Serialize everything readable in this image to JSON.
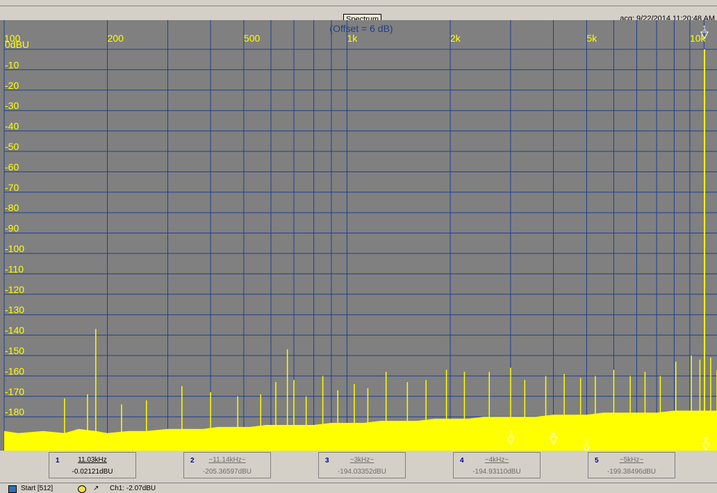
{
  "header": {
    "title": "Spectrum",
    "acq": "acq: 9/22/2014 11:20:48 AM"
  },
  "colors": {
    "plot_bg": "#808080",
    "grid": "#1f3f8c",
    "trace": "#ffff00",
    "label": "#ffff00",
    "title_label": "#1f3f8c"
  },
  "chart_data": {
    "type": "line",
    "title": "(Offset = 6 dB)",
    "xlabel": "",
    "ylabel": "",
    "x_scale": "log",
    "xlim": [
      100,
      12000
    ],
    "ylim": [
      -195,
      0
    ],
    "grid": true,
    "x_tick_labels": [
      {
        "value": 100,
        "label": "100"
      },
      {
        "value": 200,
        "label": "200"
      },
      {
        "value": 500,
        "label": "500"
      },
      {
        "value": 1000,
        "label": "1k"
      },
      {
        "value": 2000,
        "label": "2k"
      },
      {
        "value": 5000,
        "label": "5k"
      },
      {
        "value": 10000,
        "label": "10k"
      }
    ],
    "x_minor_grid": [
      300,
      400,
      600,
      700,
      800,
      900,
      3000,
      4000,
      6000,
      7000,
      8000,
      9000,
      11000
    ],
    "y_ticks": [
      {
        "value": 0,
        "label": "0dBU"
      },
      {
        "value": -10,
        "label": "-10"
      },
      {
        "value": -20,
        "label": "-20"
      },
      {
        "value": -30,
        "label": "-30"
      },
      {
        "value": -40,
        "label": "-40"
      },
      {
        "value": -50,
        "label": "-50"
      },
      {
        "value": -60,
        "label": "-60"
      },
      {
        "value": -70,
        "label": "-70"
      },
      {
        "value": -80,
        "label": "-80"
      },
      {
        "value": -90,
        "label": "-90"
      },
      {
        "value": -100,
        "label": "-100"
      },
      {
        "value": -110,
        "label": "-110"
      },
      {
        "value": -120,
        "label": "-120"
      },
      {
        "value": -130,
        "label": "-130"
      },
      {
        "value": -140,
        "label": "-140"
      },
      {
        "value": -150,
        "label": "-150"
      },
      {
        "value": -160,
        "label": "-160"
      },
      {
        "value": -170,
        "label": "-170"
      },
      {
        "value": -180,
        "label": "-180"
      }
    ],
    "series": [
      {
        "x": [
          100,
          110,
          130,
          150,
          165,
          185,
          200,
          230,
          260,
          300,
          340,
          380,
          420,
          470,
          520,
          580,
          650,
          720,
          800,
          900,
          1000,
          1120,
          1250,
          1400,
          1600,
          1800,
          2000,
          2250,
          2500,
          2800,
          3150,
          3550,
          4000,
          4500,
          5000,
          5600,
          6300,
          7100,
          8000,
          9000,
          10000,
          11030,
          11500,
          12000
        ],
        "y": [
          -187,
          -188,
          -187,
          -188,
          -186,
          -187,
          -188,
          -187,
          -187,
          -186,
          -186,
          -186,
          -185,
          -185,
          -185,
          -184,
          -184,
          -184,
          -184,
          -183,
          -183,
          -183,
          -182,
          -182,
          -182,
          -181,
          -181,
          -181,
          -180,
          -180,
          -180,
          -180,
          -179,
          -179,
          -179,
          -178,
          -178,
          -178,
          -178,
          -177,
          -177,
          -0.02121,
          -177,
          -177
        ]
      }
    ],
    "spurs": [
      {
        "x": 185,
        "y": -137
      },
      {
        "x": 150,
        "y": -171
      },
      {
        "x": 175,
        "y": -169
      },
      {
        "x": 220,
        "y": -174
      },
      {
        "x": 260,
        "y": -172
      },
      {
        "x": 330,
        "y": -165
      },
      {
        "x": 400,
        "y": -168
      },
      {
        "x": 480,
        "y": -170
      },
      {
        "x": 560,
        "y": -169
      },
      {
        "x": 620,
        "y": -163
      },
      {
        "x": 670,
        "y": -147
      },
      {
        "x": 700,
        "y": -162
      },
      {
        "x": 760,
        "y": -170
      },
      {
        "x": 850,
        "y": -160
      },
      {
        "x": 940,
        "y": -167
      },
      {
        "x": 1050,
        "y": -164
      },
      {
        "x": 1150,
        "y": -166
      },
      {
        "x": 1300,
        "y": -158
      },
      {
        "x": 1500,
        "y": -163
      },
      {
        "x": 1700,
        "y": -162
      },
      {
        "x": 1950,
        "y": -157
      },
      {
        "x": 2200,
        "y": -158
      },
      {
        "x": 2600,
        "y": -158
      },
      {
        "x": 3000,
        "y": -156
      },
      {
        "x": 3300,
        "y": -162
      },
      {
        "x": 3800,
        "y": -160
      },
      {
        "x": 4300,
        "y": -159
      },
      {
        "x": 4800,
        "y": -161
      },
      {
        "x": 5300,
        "y": -160
      },
      {
        "x": 6000,
        "y": -157
      },
      {
        "x": 6700,
        "y": -160
      },
      {
        "x": 7400,
        "y": -158
      },
      {
        "x": 8200,
        "y": -160
      },
      {
        "x": 9100,
        "y": -153
      },
      {
        "x": 10100,
        "y": -150
      },
      {
        "x": 10700,
        "y": -152
      },
      {
        "x": 11500,
        "y": -151
      },
      {
        "x": 12000,
        "y": -157
      }
    ],
    "markers": [
      {
        "id": "1",
        "x": 11030,
        "y": -0.02121,
        "label": "1"
      },
      {
        "id": "2",
        "x": 11140,
        "y": -193,
        "label": "2"
      },
      {
        "id": "3",
        "x": 3000,
        "y": -190,
        "label": "3"
      },
      {
        "id": "4",
        "x": 4000,
        "y": -190,
        "label": "4"
      },
      {
        "id": "5",
        "x": 5000,
        "y": -194,
        "label": "5"
      }
    ]
  },
  "markers_panel": [
    {
      "num": "1",
      "freq": "11.03kHz",
      "amp": "-0.02121dBU",
      "active": true
    },
    {
      "num": "2",
      "freq": "~11.14kHz~",
      "amp": "-205.36597dBU",
      "active": false
    },
    {
      "num": "3",
      "freq": "~3kHz~",
      "amp": "-194.03352dBU",
      "active": false
    },
    {
      "num": "4",
      "freq": "~4kHz~",
      "amp": "-194.93110dBU",
      "active": false
    },
    {
      "num": "5",
      "freq": "~5kHz~",
      "amp": "-199.38496dBU",
      "active": false
    }
  ],
  "status": {
    "start": "Start [512]",
    "channel": "Ch1: -2.07dBU"
  }
}
